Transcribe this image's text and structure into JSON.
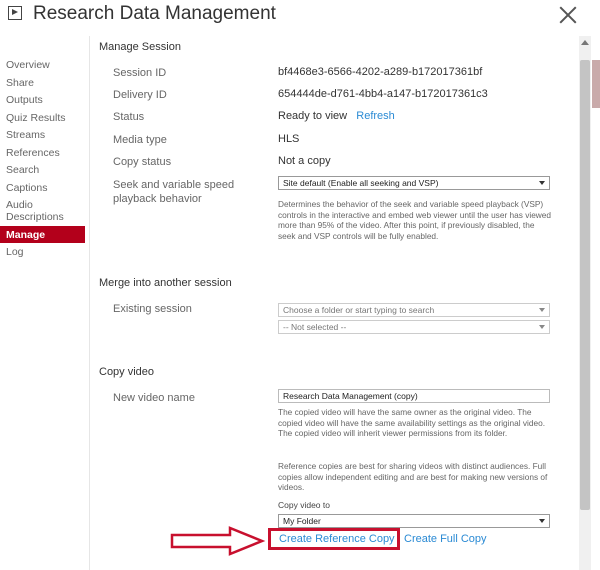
{
  "window": {
    "title": "Research Data Management"
  },
  "sidebar": {
    "items": [
      {
        "label": "Overview"
      },
      {
        "label": "Share"
      },
      {
        "label": "Outputs"
      },
      {
        "label": "Quiz Results"
      },
      {
        "label": "Streams"
      },
      {
        "label": "References"
      },
      {
        "label": "Search"
      },
      {
        "label": "Captions"
      },
      {
        "label": "Audio Descriptions"
      },
      {
        "label": "Manage",
        "active": true
      },
      {
        "label": "Log"
      }
    ]
  },
  "manage_session": {
    "title": "Manage Session",
    "session_id": {
      "label": "Session ID",
      "value": "bf4468e3-6566-4202-a289-b172017361bf"
    },
    "delivery_id": {
      "label": "Delivery ID",
      "value": "654444de-d761-4bb4-a147-b172017361c3"
    },
    "status": {
      "label": "Status",
      "value": "Ready to view",
      "refresh": "Refresh"
    },
    "media_type": {
      "label": "Media type",
      "value": "HLS"
    },
    "copy_status": {
      "label": "Copy status",
      "value": "Not a copy"
    },
    "seek": {
      "label": "Seek and variable speed playback behavior",
      "selected": "Site default (Enable all seeking and VSP)",
      "help": "Determines the behavior of the seek and variable speed playback (VSP) controls in the interactive and embed web viewer until the user has viewed more than 95% of the video. After this point, if previously disabled, the seek and VSP controls will be fully enabled."
    }
  },
  "merge": {
    "title": "Merge into another session",
    "existing_label": "Existing session",
    "folder_placeholder": "Choose a folder or start typing to search",
    "session_placeholder": "-- Not selected --"
  },
  "copy_video": {
    "title": "Copy video",
    "name_label": "New video name",
    "name_value": "Research Data Management (copy)",
    "help1": "The copied video will have the same owner as the original video. The copied video will have the same availability settings as the original video. The copied video will inherit viewer permissions from its folder.",
    "help2": "Reference copies are best for sharing videos with distinct audiences. Full copies allow independent editing and are best for making new versions of videos.",
    "copy_to_label": "Copy video to",
    "folder": "My Folder",
    "create_reference": "Create Reference Copy",
    "create_full": "Create Full Copy"
  },
  "annotation": {
    "arrow_color": "#c8102e",
    "box_color": "#c8102e"
  },
  "colors": {
    "accent": "#b3001b",
    "link": "#2a8ad4"
  }
}
